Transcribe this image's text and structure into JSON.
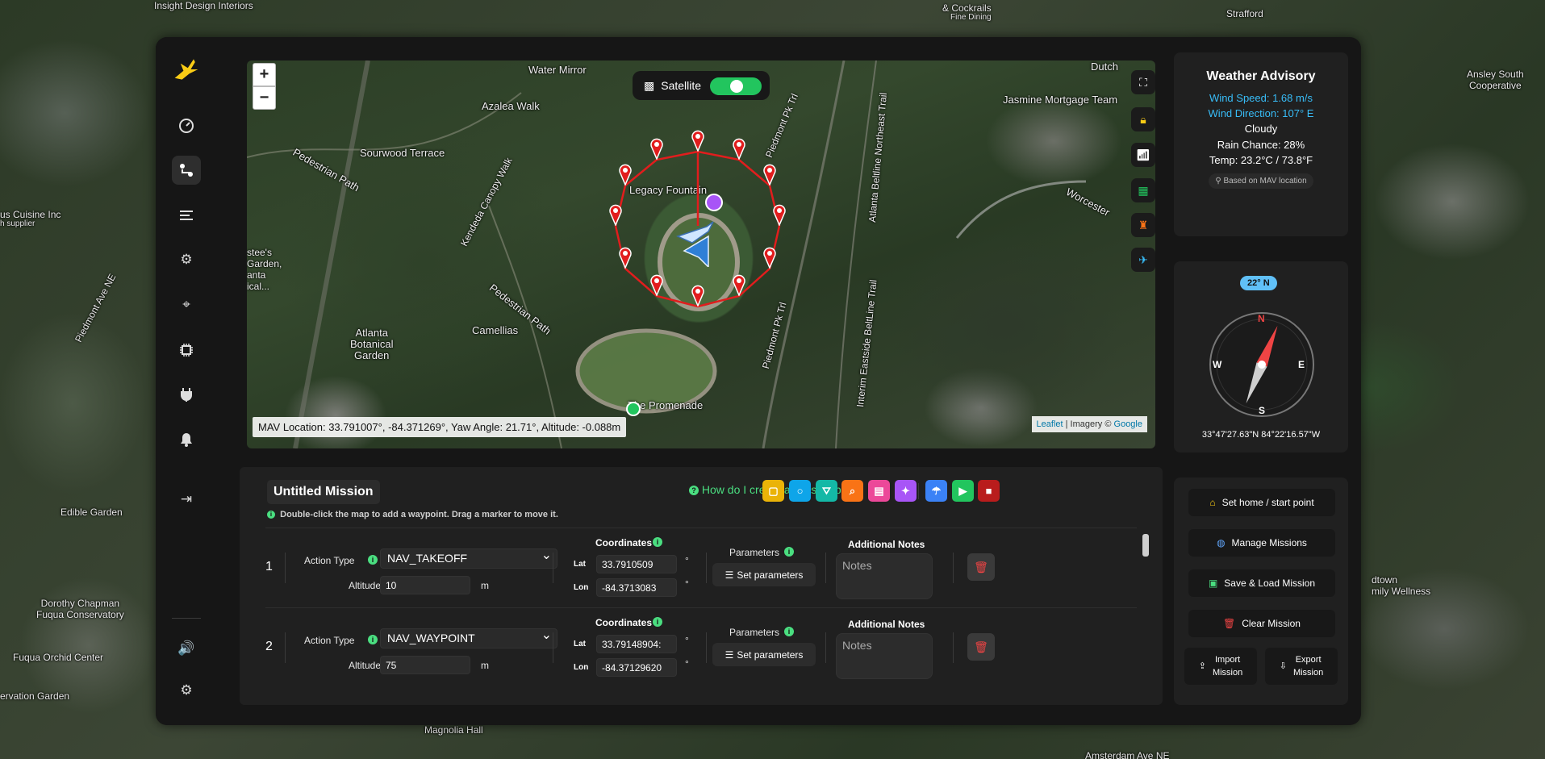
{
  "background_labels": {
    "insight": "Insight Design Interiors",
    "castle": "& Cockrails",
    "fine": "Fine Dining",
    "strafford": "Strafford",
    "ansley": "Ansley South\nCooperative",
    "cuisine": "us Cuisine Inc",
    "supplier": "h supplier",
    "piedmont_ave": "Piedmont Ave NE",
    "edible": "Edible Garden",
    "dorothy": "Dorothy Chapman\nFuqua Conservatory",
    "orchid": "Fuqua Orchid Center",
    "ervation": "ervation Garden",
    "magnolia": "Magnolia Hall",
    "amsterdam": "Amsterdam Ave NE",
    "midtown": "dtown\nmily Wellness",
    "worcester": "Worcester Dr NE"
  },
  "map": {
    "zoom_in": "+",
    "zoom_out": "−",
    "satellite_label": "Satellite",
    "satellite_on": true,
    "labels": {
      "water_mirror": "Water Mirror",
      "azalea": "Azalea Walk",
      "sourwood": "Sourwood Terrace",
      "pedestrian1": "Pedestrian Path",
      "kendeda": "Kendeda Canopy Walk",
      "pedestrian2": "Pedestrian Path",
      "camellias": "Camellias",
      "atlanta_bot": "Atlanta\nBotanical\nGarden",
      "fountain": "Legacy Fountain",
      "promenade": "The Promenade",
      "piedmont_pk": "Piedmont Pk Trl",
      "piedmont_pk2": "Piedmont Pk Trl",
      "beltline": "Atlanta Beltline Northeast Trail",
      "interim": "Interim Eastside BeltLine Trail",
      "jasmine": "Jasmine Mortgage Team",
      "worcester": "Worcester",
      "dutch": "Dutch",
      "stees": "stee's\nGarden,\nanta\nical..."
    },
    "mav_info": "MAV Location: 33.791007°, -84.371269°, Yaw Angle: 21.71°, Altitude: -0.088m",
    "attribution_leaflet": "Leaflet",
    "attribution_sep": "|",
    "attribution_imagery": "Imagery ©",
    "attribution_google": "Google"
  },
  "mission": {
    "title": "Untitled Mission",
    "help": "How do I create a mission plan?",
    "hint": "Double-click the map to add a waypoint. Drag a marker to move it.",
    "tools": [
      {
        "name": "rectangle-tool",
        "color": "#eab308",
        "glyph": "▢"
      },
      {
        "name": "circle-tool",
        "color": "#0ea5e9",
        "glyph": "○"
      },
      {
        "name": "road-tool",
        "color": "#14b8a6",
        "glyph": "⛛"
      },
      {
        "name": "search-tool",
        "color": "#f97316",
        "glyph": "⌕"
      },
      {
        "name": "building-tool",
        "color": "#ec4899",
        "glyph": "▤"
      },
      {
        "name": "magic-tool",
        "color": "#a855f7",
        "glyph": "✦"
      },
      {
        "name": "parachute-tool",
        "color": "#3b82f6",
        "glyph": "☂"
      },
      {
        "name": "play-tool",
        "color": "#22c55e",
        "glyph": "▶"
      },
      {
        "name": "stop-tool",
        "color": "#b91c1c",
        "glyph": "■"
      }
    ],
    "labels": {
      "action_type": "Action Type",
      "altitude": "Altitude",
      "unit_m": "m",
      "coordinates": "Coordinates",
      "lat": "Lat",
      "lon": "Lon",
      "parameters": "Parameters",
      "set_parameters": "Set parameters",
      "notes_title": "Additional Notes",
      "notes_placeholder": "Notes",
      "degree": "°"
    },
    "waypoints": [
      {
        "num": "1",
        "action": "NAV_TAKEOFF",
        "altitude": "10",
        "lat": "33.7910509",
        "lon": "-84.3713083"
      },
      {
        "num": "2",
        "action": "NAV_WAYPOINT",
        "altitude": "75",
        "lat": "33.79148904:",
        "lon": "-84.37129620"
      }
    ]
  },
  "weather": {
    "title": "Weather Advisory",
    "wind_speed": "Wind Speed: 1.68 m/s",
    "wind_direction": "Wind Direction: 107° E",
    "condition": "Cloudy",
    "rain": "Rain Chance: 28%",
    "temp": "Temp: 23.2°C / 73.8°F",
    "based_on": "Based on MAV location",
    "accent": "#38bdf8"
  },
  "compass": {
    "heading_badge": "22° N",
    "heading_deg": 22,
    "n": "N",
    "e": "E",
    "s": "S",
    "w": "W",
    "coords": "33°47'27.63\"N 84°22'16.57\"W"
  },
  "actions": {
    "home": "Set home / start point",
    "manage": "Manage Missions",
    "save": "Save & Load Mission",
    "clear": "Clear Mission",
    "import": "Import\nMission",
    "export": "Export\nMission"
  }
}
